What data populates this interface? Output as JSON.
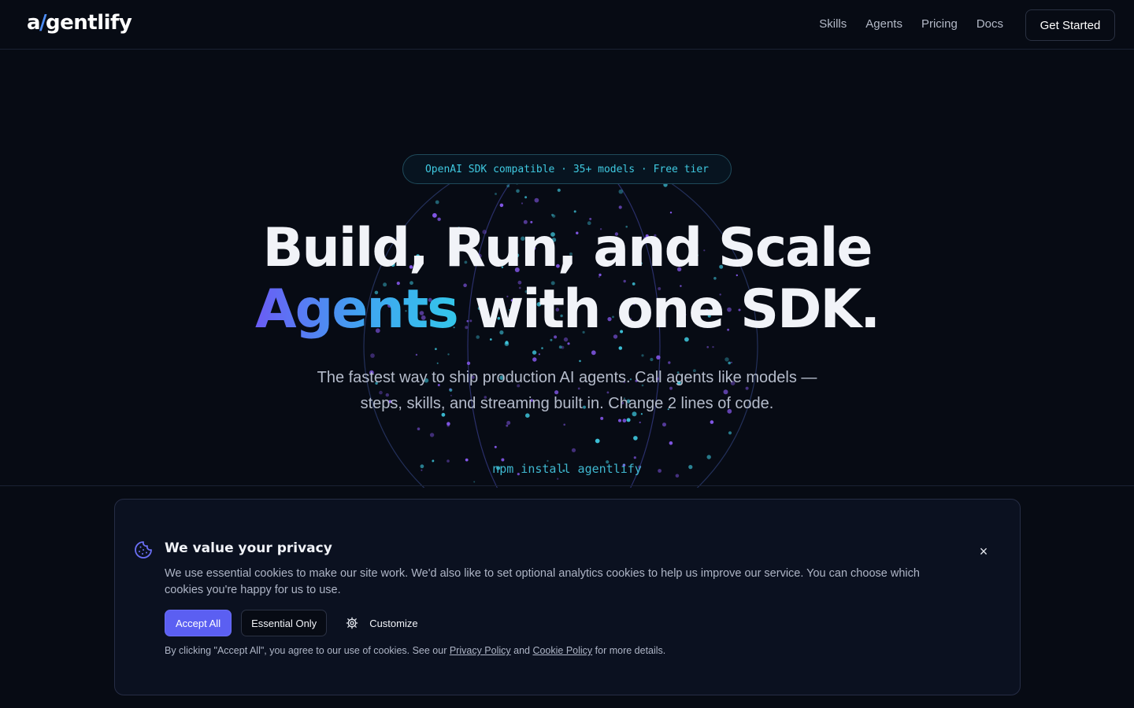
{
  "nav": {
    "logo_a": "a",
    "logo_slash": "/",
    "logo_rest": "gentlify",
    "links": [
      "Skills",
      "Agents",
      "Pricing",
      "Docs"
    ],
    "cta": "Get Started"
  },
  "hero": {
    "badge": "OpenAI SDK compatible · 35+ models · Free tier",
    "headline_line1": "Build, Run, and Scale",
    "headline_gradient": "Agents",
    "headline_line2_rest": " with one SDK.",
    "subtitle": "The fastest way to ship production AI agents. Call agents like models — steps, skills, and streaming built in. Change 2 lines of code.",
    "install_command": "npm install agentlify"
  },
  "cookie": {
    "title": "We value your privacy",
    "body": "We use essential cookies to make our site work. We'd also like to set optional analytics cookies to help us improve our service. You can choose which cookies you're happy for us to use.",
    "accept_label": "Accept All",
    "essential_label": "Essential Only",
    "customize_label": "Customize",
    "footer_prefix": "By clicking \"Accept All\", you agree to our use of cookies. See our ",
    "privacy_link": "Privacy Policy",
    "footer_and": " and ",
    "cookie_link": "Cookie Policy",
    "footer_suffix": " for more details.",
    "close_symbol": "×"
  },
  "colors": {
    "background": "#070b14",
    "accent": "#5b5ff2",
    "cyan": "#3fc9e0",
    "purple": "#8b5cf6"
  },
  "icons": [
    "cookie-icon",
    "close-icon",
    "gear-icon"
  ]
}
